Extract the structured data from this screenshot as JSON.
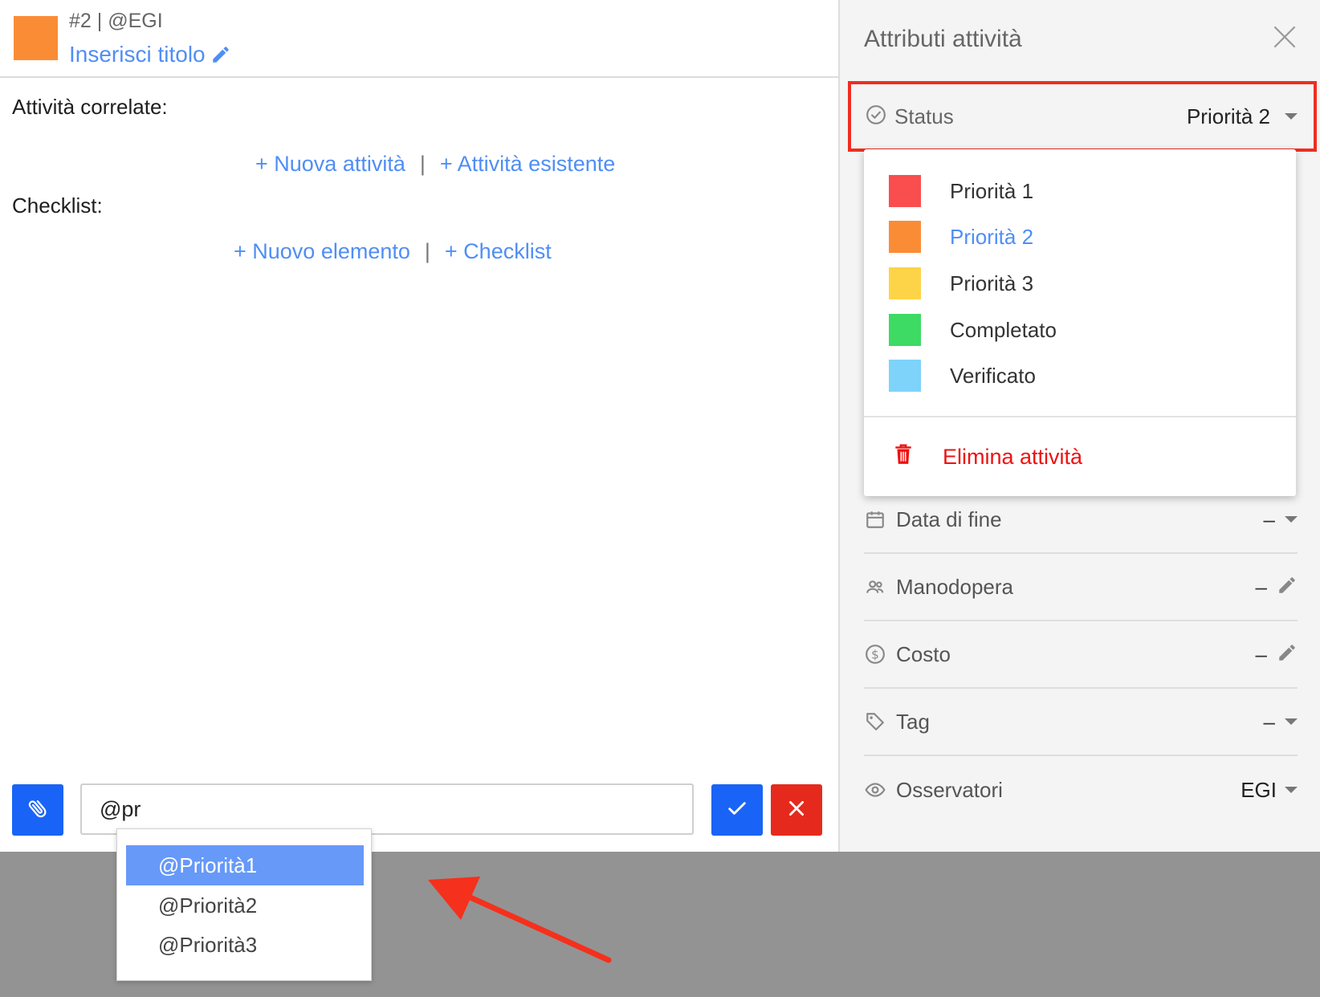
{
  "header": {
    "meta": "#2 | @EGI",
    "title_link": "Inserisci titolo",
    "swatch_color": "#fb8c36"
  },
  "related": {
    "label": "Attività correlate:",
    "new_link": "+ Nuova attività",
    "existing_link": "+ Attività esistente",
    "separator": "|"
  },
  "checklist": {
    "label": "Checklist:",
    "new_item_link": "+ Nuovo elemento",
    "checklist_link": "+ Checklist",
    "separator": "|"
  },
  "comment": {
    "value": "@pr",
    "mention_suggestions": [
      "@Priorità1",
      "@Priorità2",
      "@Priorità3"
    ],
    "active_index": 0
  },
  "panel": {
    "title": "Attributi attività",
    "status": {
      "label": "Status",
      "value": "Priorità 2"
    },
    "status_options": [
      {
        "label": "Priorità 1",
        "color": "#fa4d4d"
      },
      {
        "label": "Priorità 2",
        "color": "#fb8c36"
      },
      {
        "label": "Priorità 3",
        "color": "#fdd447"
      },
      {
        "label": "Completato",
        "color": "#3ddb63"
      },
      {
        "label": "Verificato",
        "color": "#7dd3fa"
      }
    ],
    "delete_label": "Elimina attività",
    "rows": [
      {
        "label": "Data di fine",
        "value": "–",
        "icon": "calendar-icon"
      },
      {
        "label": "Manodopera",
        "value": "–",
        "icon": "people-icon"
      },
      {
        "label": "Costo",
        "value": "–",
        "icon": "dollar-circle-icon"
      },
      {
        "label": "Tag",
        "value": "–",
        "icon": "tag-icon"
      },
      {
        "label": "Osservatori",
        "value": "EGI",
        "icon": "eye-icon"
      }
    ]
  },
  "colors": {
    "accent": "#4f8ef5",
    "primary_button": "#1964f6",
    "danger": "#e52a1d",
    "highlight_border": "#ef2d21"
  }
}
